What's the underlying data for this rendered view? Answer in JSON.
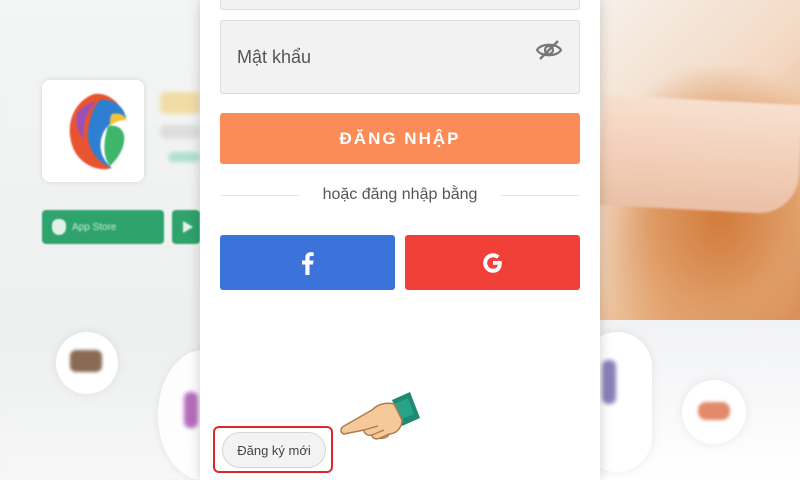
{
  "login_form": {
    "password_placeholder": "Mật khẩu",
    "login_button_label": "ĐĂNG NHẬP",
    "alt_login_text": "hoặc đăng nhập bằng",
    "facebook_glyph": "f",
    "register_button_label": "Đăng ký mới"
  },
  "icons": {
    "password_toggle": "eye-slash-icon",
    "facebook": "facebook-icon",
    "google": "google-icon",
    "pointer": "pointing-hand-icon"
  },
  "background": {
    "store_badge_text": "App Store"
  },
  "colors": {
    "login_button": "#fb8c57",
    "facebook": "#3b73db",
    "google": "#f04037",
    "highlight_box": "#e0262b"
  }
}
